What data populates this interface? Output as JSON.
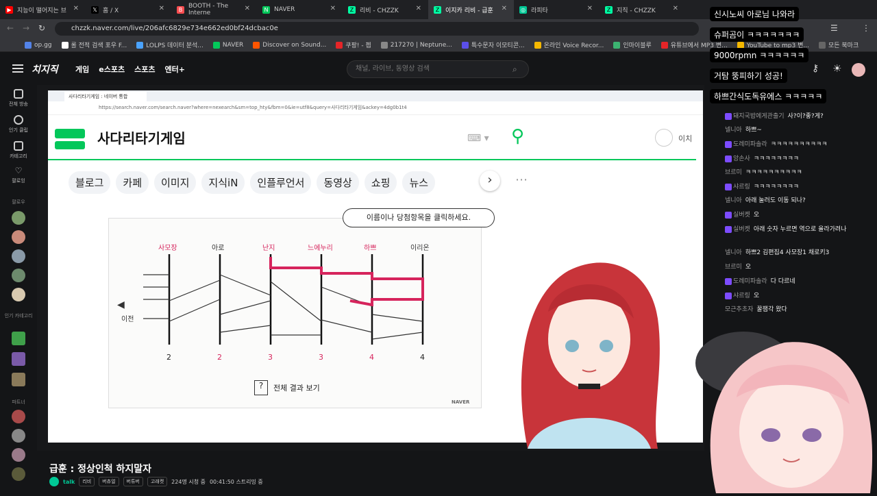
{
  "browser": {
    "tabs": [
      {
        "label": "지능이 떨어지는 브",
        "color": "#ff0000"
      },
      {
        "label": "홈 / X",
        "color": "#000000"
      },
      {
        "label": "BOOTH - The Interne",
        "color": "#fc4d50"
      },
      {
        "label": "NAVER",
        "color": "#03c75a"
      },
      {
        "label": "리비 - CHZZK",
        "color": "#1f2023"
      },
      {
        "label": "이지카 리비 - 급훈",
        "color": "#1f2023"
      },
      {
        "label": "라피타",
        "color": "#1f2023"
      },
      {
        "label": "지직 - CHZZK",
        "color": "#1f2023"
      }
    ],
    "url": "chzzk.naver.com/live/206afc6829e734e662ed0bf24dcbac0e",
    "bookmarks": [
      "op.gg",
      "롤 전적 검색 포우 F...",
      "LOLPS 데이터 분석...",
      "NAVER",
      "Discover on Sound...",
      "쿠팡! - 쳅",
      "217270 | Neptune...",
      "특수문자 이모티콘...",
      "온라인 Voice Recor...",
      "인마이블루",
      "유튜브에서 MP3 변...",
      "YouTube to mp3 변...",
      "모든 북마크"
    ]
  },
  "site": {
    "logo": "치지직",
    "nav": [
      "게임",
      "e스포츠",
      "스포츠",
      "엔터+"
    ],
    "search_placeholder": "채널, 라이브, 동영상 검색"
  },
  "sidebar": {
    "items": [
      "전체 방송",
      "인기 클립",
      "카테고리",
      "팔로잉"
    ],
    "following_label": "팔로우",
    "category_label": "인기 카테고리",
    "partner_label": "파트너"
  },
  "inner_browser": {
    "tab_title": "사다리타기게임 : 네이버 통합",
    "url": "https://search.naver.com/search.naver?where=nexearch&sm=top_hty&fbm=0&ie=utf8&query=사다리타기게임&ackey=4dg0b1t4",
    "query": "사다리타기게임",
    "login_label": "이치",
    "categories": [
      "블로그",
      "카페",
      "이미지",
      "지식iN",
      "인플루언서",
      "동영상",
      "쇼핑",
      "뉴스"
    ],
    "hint": "이름이나 당첨항목을 클릭하세요.",
    "prev_label": "이전",
    "names": [
      "사모장",
      "아로",
      "난지",
      "느에누리",
      "하쁘",
      "이리온"
    ],
    "results": [
      "2",
      "2",
      "3",
      "3",
      "4",
      "4"
    ],
    "result_button": "전체 결과 보기",
    "brand": "NAVER"
  },
  "chat": {
    "donations": [
      {
        "text": "신시노씨 아로님 나와라"
      },
      {
        "text": "슈퍼곰이 ㅋㅋㅋㅋㅋㅋㅋ"
      },
      {
        "text": "9000rpmn ㅋㅋㅋㅋㅋㅋ"
      },
      {
        "text": "거탐 뚱피하기 성공!"
      },
      {
        "text": "하쁘간식도독유에스 ㅋㅋㅋㅋㅋ"
      }
    ],
    "messages": [
      {
        "nick": "돼지국밥에게관출기",
        "text": "사?이?좋?게?"
      },
      {
        "nick": "넬니아",
        "text": "하쁘~"
      },
      {
        "nick": "도레미파솔라",
        "text": "ㅋㅋㅋㅋㅋㅋㅋㅋㅋㅋ"
      },
      {
        "nick": "앙손사",
        "text": "ㅋㅋㅋㅋㅋㅋㅋㅋ"
      },
      {
        "nick": "브르미",
        "text": "ㅋㅋㅋㅋㅋㅋㅋㅋㅋㅋ"
      },
      {
        "nick": "샤르링",
        "text": "ㅋㅋㅋㅋㅋㅋㅋㅋ"
      },
      {
        "nick": "넬니아",
        "text": "아래 눌러도 이동 되나?"
      },
      {
        "nick": "실버켓",
        "text": "오"
      },
      {
        "nick": "실버켓",
        "text": "아래 숫자 누르면 역으로 올라가려나"
      },
      {
        "nick": "넬니아",
        "text": "하쁘2 김편집4 사모장1 채로키3"
      },
      {
        "nick": "브르미",
        "text": "오"
      },
      {
        "nick": "도레미파솔라",
        "text": "다 다르네"
      },
      {
        "nick": "샤르링",
        "text": "오"
      },
      {
        "nick": "모근추초자",
        "text": "꿀잼각 왔다"
      }
    ]
  },
  "stream": {
    "title": "급훈 : 정상인척 하지말자",
    "talk_label": "talk",
    "tags": [
      "리비",
      "버츄얼",
      "버튜버",
      "고래켓"
    ],
    "viewers": "224명 시청 중",
    "uptime": "00:41:50 스트리밍 중"
  }
}
